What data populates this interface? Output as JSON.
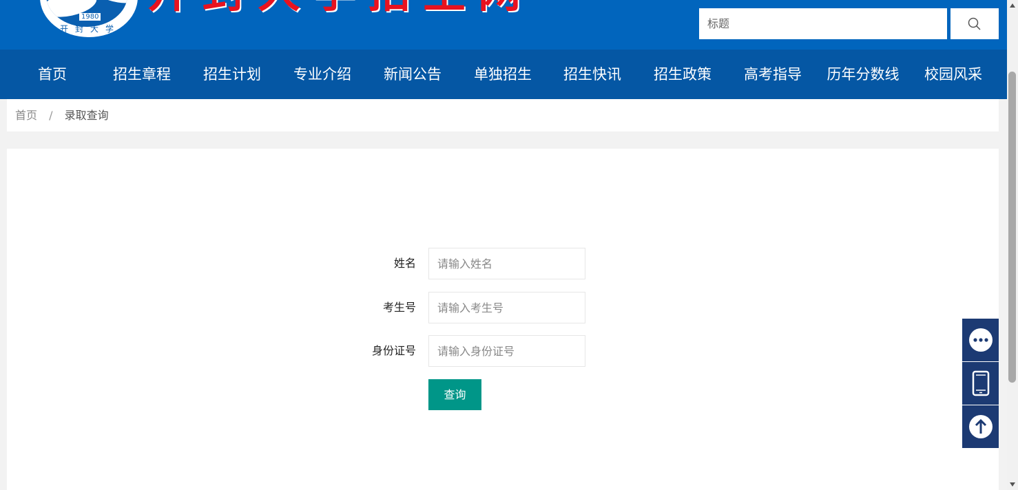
{
  "header": {
    "logo_year": "1980",
    "logo_ring_text": "开封大学",
    "title_partial": "开封大学招生网",
    "search": {
      "placeholder": "标题",
      "button_icon": "search-icon"
    }
  },
  "nav": {
    "items": [
      {
        "label": "首页"
      },
      {
        "label": "招生章程"
      },
      {
        "label": "招生计划"
      },
      {
        "label": "专业介绍"
      },
      {
        "label": "新闻公告"
      },
      {
        "label": "单独招生"
      },
      {
        "label": "招生快讯"
      },
      {
        "label": "招生政策"
      },
      {
        "label": "高考指导"
      },
      {
        "label": "历年分数线"
      },
      {
        "label": "校园风采"
      }
    ]
  },
  "breadcrumb": {
    "home": "首页",
    "separator": "/",
    "current": "录取查询"
  },
  "form": {
    "name": {
      "label": "姓名",
      "placeholder": "请输入姓名"
    },
    "exam_no": {
      "label": "考生号",
      "placeholder": "请输入考生号"
    },
    "id_no": {
      "label": "身份证号",
      "placeholder": "请输入身份证号"
    },
    "submit_label": "查询"
  },
  "float_bar": {
    "icons": [
      "chat-icon",
      "mobile-icon",
      "back-to-top-icon"
    ]
  },
  "colors": {
    "header": "#0165bd",
    "nav": "#0557a4",
    "submit": "#009688",
    "float": "#1c3a73"
  }
}
